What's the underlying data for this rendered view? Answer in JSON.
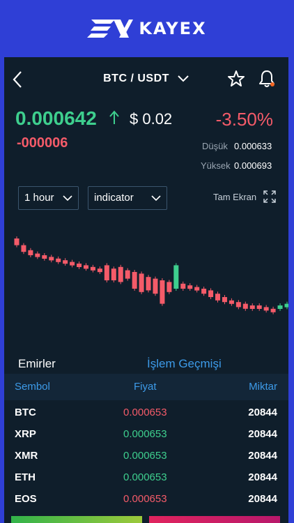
{
  "brand": {
    "name": "KAYEX"
  },
  "header": {
    "pair": "BTC / USDT"
  },
  "ticker": {
    "price": "0.000642",
    "usd": "$ 0.02",
    "change_pct": "-3.50%",
    "delta": "-000006",
    "low_label": "Düşük",
    "low_value": "0.000633",
    "high_label": "Yüksek",
    "high_value": "0.000693"
  },
  "controls": {
    "interval": "1 hour",
    "indicator": "indicator",
    "fullscreen": "Tam Ekran"
  },
  "chart_data": {
    "type": "candlestick",
    "candles": [
      {
        "o": 0.00068,
        "c": 0.000676
      },
      {
        "o": 0.000676,
        "c": 0.000672
      },
      {
        "o": 0.000673,
        "c": 0.00067
      },
      {
        "o": 0.000671,
        "c": 0.000669
      },
      {
        "o": 0.00067,
        "c": 0.000668
      },
      {
        "o": 0.000669,
        "c": 0.000667
      },
      {
        "o": 0.000668,
        "c": 0.000666
      },
      {
        "o": 0.000667,
        "c": 0.000665
      },
      {
        "o": 0.000666,
        "c": 0.000664
      },
      {
        "o": 0.000665,
        "c": 0.000663
      },
      {
        "o": 0.000664,
        "c": 0.000662
      },
      {
        "o": 0.000663,
        "c": 0.000661
      },
      {
        "o": 0.000662,
        "c": 0.00066
      },
      {
        "o": 0.000664,
        "c": 0.000655
      },
      {
        "o": 0.000662,
        "c": 0.000655
      },
      {
        "o": 0.000663,
        "c": 0.000654
      },
      {
        "o": 0.000661,
        "c": 0.000656
      },
      {
        "o": 0.00066,
        "c": 0.00065
      },
      {
        "o": 0.000659,
        "c": 0.000648
      },
      {
        "o": 0.000657,
        "c": 0.000649
      },
      {
        "o": 0.000656,
        "c": 0.000647
      },
      {
        "o": 0.000655,
        "c": 0.000641
      },
      {
        "o": 0.000654,
        "c": 0.000648
      },
      {
        "o": 0.00065,
        "c": 0.000664
      },
      {
        "o": 0.000653,
        "c": 0.00065
      },
      {
        "o": 0.000652,
        "c": 0.00065
      },
      {
        "o": 0.000651,
        "c": 0.000649
      },
      {
        "o": 0.00065,
        "c": 0.000647
      },
      {
        "o": 0.000649,
        "c": 0.000645
      },
      {
        "o": 0.000647,
        "c": 0.000643
      },
      {
        "o": 0.000645,
        "c": 0.000642
      },
      {
        "o": 0.000643,
        "c": 0.000641
      },
      {
        "o": 0.000642,
        "c": 0.000639
      },
      {
        "o": 0.000641,
        "c": 0.000638
      },
      {
        "o": 0.00064,
        "c": 0.000638
      },
      {
        "o": 0.00064,
        "c": 0.000638
      },
      {
        "o": 0.000639,
        "c": 0.000637
      },
      {
        "o": 0.000638,
        "c": 0.000636
      },
      {
        "o": 0.000638,
        "c": 0.00064
      },
      {
        "o": 0.000639,
        "c": 0.000641
      }
    ],
    "ylim": [
      0.00063,
      0.00069
    ]
  },
  "orders": {
    "tab_orders": "Emirler",
    "tab_history": "İşlem Geçmişi",
    "col_symbol": "Sembol",
    "col_price": "Fiyat",
    "col_qty": "Miktar",
    "rows": [
      {
        "symbol": "BTC",
        "price": "0.000653",
        "qty": "20844",
        "color": "#f45b69"
      },
      {
        "symbol": "XRP",
        "price": "0.000653",
        "qty": "20844",
        "color": "#3ecf8e"
      },
      {
        "symbol": "XMR",
        "price": "0.000653",
        "qty": "20844",
        "color": "#3ecf8e"
      },
      {
        "symbol": "ETH",
        "price": "0.000653",
        "qty": "20844",
        "color": "#3ecf8e"
      },
      {
        "symbol": "EOS",
        "price": "0.000653",
        "qty": "20844",
        "color": "#f45b69"
      }
    ]
  },
  "colors": {
    "up": "#3ecf8e",
    "down": "#f45b69",
    "accent": "#3d9be9",
    "background": "#0f1e2b"
  }
}
